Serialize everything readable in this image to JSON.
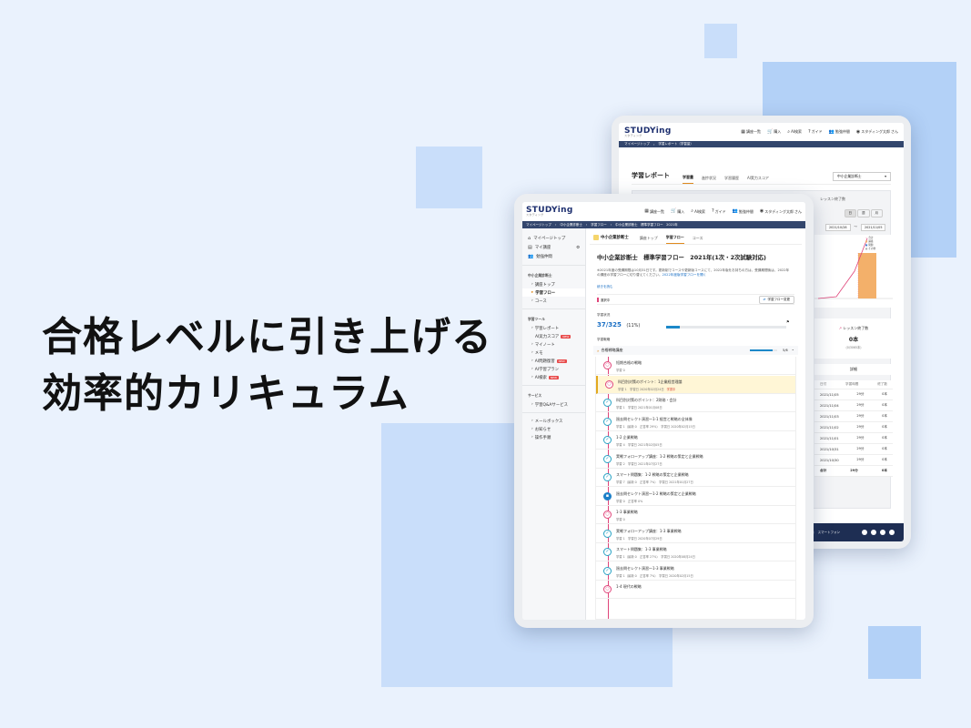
{
  "headline": {
    "line1": "合格レベルに引き上げる",
    "line2": "効率的カリキュラム"
  },
  "colors": {
    "background": "#eaf2fd",
    "decoration": "#c9defa",
    "navy": "#33466d",
    "accent": "#e08a1e",
    "pink": "#e0457a",
    "teal": "#27a2c4"
  },
  "logo": {
    "text": "STUDYing",
    "sub": "スタディング"
  },
  "topnav": {
    "course_list": "講座一覧",
    "purchase": "購入",
    "ai_search": "AI検索",
    "guide": "ガイド",
    "study_partner": "勉強仲間",
    "user": "スタディング太郎",
    "user_suffix": "さん"
  },
  "front": {
    "breadcrumb": [
      "マイページトップ",
      "中小企業診断士",
      "学習フロー",
      "中小企業診断士　標準学習フロー　2021年"
    ],
    "sidebar": {
      "mypage": "マイページトップ",
      "my_course": "マイ講座",
      "partner": "勉強仲間",
      "sec_course": "中小企業診断士",
      "course_top": "講座トップ",
      "flow": "学習フロー",
      "course": "コース",
      "sec_tools": "学習ツール",
      "report": "学習レポート",
      "ai_score": "AI実力スコア",
      "mynote": "マイノート",
      "memo": "メモ",
      "ai_qa": "AI問題復習",
      "ai_plan": "AI学習プラン",
      "ai_search": "AI検索",
      "new": "NEW",
      "sec_service": "サービス",
      "qa_service": "学習Q&Aサービス",
      "mailbox": "メールボックス",
      "news": "お知らせ",
      "manual": "操作手順"
    },
    "course_title": "中小企業診断士",
    "tabs": [
      "講座トップ",
      "学習フロー",
      "コース"
    ],
    "flow_title": "中小企業診断士　標準学習フロー　2021年(1次・2次試験対応)",
    "desc1": "※2021年度の受講期限は10月31日です。更新制でコースや更新版コースにて、2022年版をお持ちの方は、受講期間後は、2022年の講座の学習フローに切り替えてください。",
    "desc_link": "2022年度版学習フローを開く",
    "more": "続きを読む",
    "selected": "選択中",
    "change_flow": "学習フロー変更",
    "status_label": "学習状況",
    "progress_text": "37/325",
    "progress_pct": "(11%)",
    "progress_fraction": 0.11,
    "strategy_label": "学習戦略",
    "section_name": "合格戦略講座",
    "section_count": "5/6",
    "section_fraction": 0.83,
    "lessons": [
      {
        "name": "短期合格の戦略",
        "meta": "学習 0",
        "state": "pink"
      },
      {
        "name": "科目別対策のポイント：1企業経営理論",
        "meta": "学習 1　学習日 2020年02月24日",
        "tag": "学習中",
        "state": "pink",
        "hl": true
      },
      {
        "name": "科目別対策のポイント：2財務・会計",
        "meta": "学習 1　学習日 2021年01月08日",
        "state": "check"
      },
      {
        "name": "過去問セレクト演習～1-1 経営と戦略の全体像",
        "meta": "学習 1（最新 0　正答率 29%）　学習日 2020年02月15日",
        "state": "check"
      },
      {
        "name": "1-2 企業戦略",
        "meta": "学習 4　学習日 2021年02月05日",
        "state": "check"
      },
      {
        "name": "実戦フォローアップ講座：1-2 戦略の策定と企業戦略",
        "meta": "学習 2　学習日 2021年07月27日",
        "state": "check"
      },
      {
        "name": "スマート問題集：1-2 戦略の策定と企業戦略",
        "meta": "学習 7（最新 0　正答率 7%）　学習日 2021年01月27日",
        "state": "check"
      },
      {
        "name": "過去問セレクト演習～1-2 戦略の策定と企業戦略",
        "meta": "学習 0　正答率 0%",
        "state": "fill"
      },
      {
        "name": "1-3 事業戦略",
        "meta": "学習 0",
        "state": "pink"
      },
      {
        "name": "実戦フォローアップ講座：1-3 事業戦略",
        "meta": "学習 1　学習日 2020年07月29日",
        "state": "check"
      },
      {
        "name": "スマート問題集：1-3 事業戦略",
        "meta": "学習 1（最新 0　正答率 27%）　学習日 2020年08月24日",
        "state": "check"
      },
      {
        "name": "過去問セレクト演習～1-3 事業戦略",
        "meta": "学習 1（最新 0　正答率 7%）　学習日 2020年02月15日",
        "state": "check"
      },
      {
        "name": "1-4 現代の戦略",
        "meta": "",
        "state": "pink"
      }
    ]
  },
  "back": {
    "breadcrumb": [
      "マイページトップ",
      "学習レポート（学習量）"
    ],
    "page_title": "学習レポート",
    "tabs": [
      "学習量",
      "進捗状況",
      "学習履歴",
      "AI実力スコア"
    ],
    "course_select": "中小企業診断士",
    "lesson_done_label": "レッスン終了数",
    "lesson_done_count": "0本",
    "lesson_done_note": "(0/3065本)",
    "date_from": "2021/10/28",
    "date_to": "2021/11/05",
    "period_btns": [
      "日",
      "週",
      "月"
    ],
    "legend": [
      "合計",
      "講義",
      "問題",
      "その他"
    ],
    "detail_label": "詳細",
    "table_header": [
      "日付",
      "学習時間",
      "終了数"
    ],
    "table_rows": [
      [
        "2021/11/05",
        "29分",
        "0本"
      ],
      [
        "2021/11/04",
        "29分",
        "0本"
      ],
      [
        "2021/11/03",
        "29分",
        "0本"
      ],
      [
        "2021/11/02",
        "29分",
        "0本"
      ],
      [
        "2021/11/01",
        "29分",
        "0本"
      ],
      [
        "2021/10/31",
        "29分",
        "0本"
      ],
      [
        "2021/10/30",
        "29分",
        "0本"
      ],
      [
        "合計",
        "29分",
        "0本"
      ]
    ],
    "footer_app": "スマートフォン"
  }
}
